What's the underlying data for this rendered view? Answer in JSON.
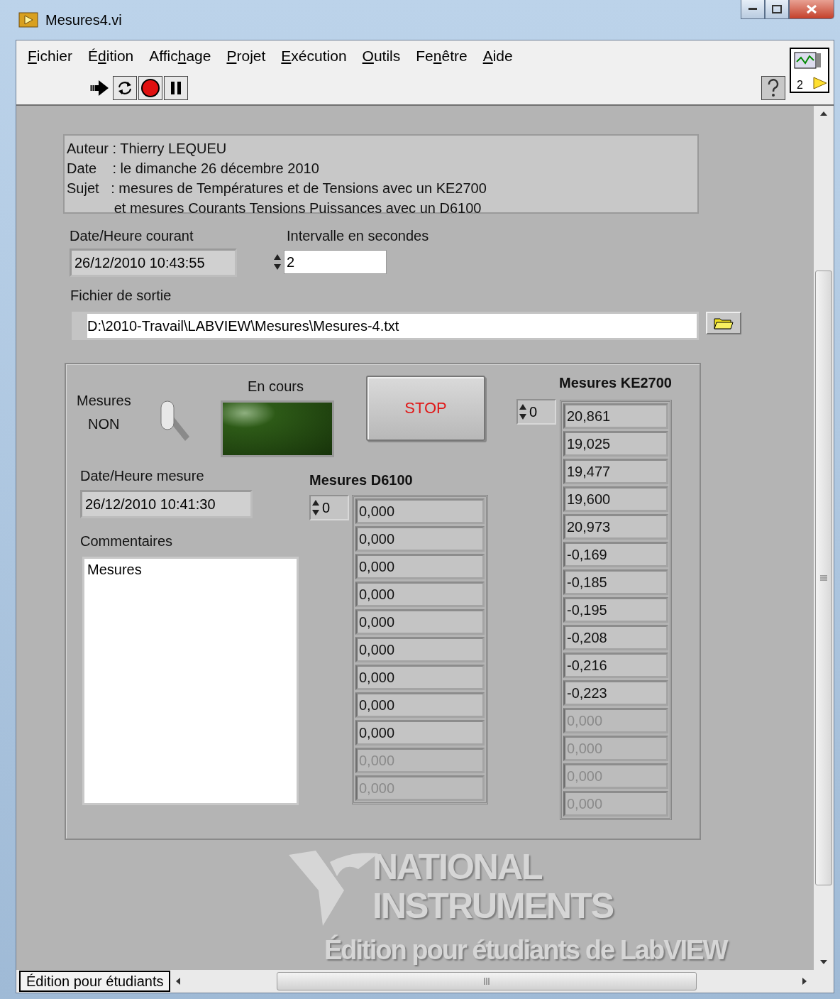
{
  "window": {
    "title": "Mesures4.vi"
  },
  "menu": [
    {
      "key": "F",
      "post": "ichier"
    },
    {
      "pre": "É",
      "key": "d",
      "post": "ition"
    },
    {
      "pre": "Affic",
      "key": "h",
      "post": "age"
    },
    {
      "key": "P",
      "post": "rojet"
    },
    {
      "key": "E",
      "post": "xécution"
    },
    {
      "key": "O",
      "post": "utils"
    },
    {
      "pre": "Fe",
      "key": "n",
      "post": "être"
    },
    {
      "key": "A",
      "post": "ide"
    }
  ],
  "connector_pane": {
    "label": "2"
  },
  "description": {
    "lines": [
      "Auteur : Thierry LEQUEU",
      "Date    : le dimanche 26 décembre 2010",
      "Sujet   : mesures de Températures et de Tensions avec un KE2700",
      "            et mesures Courants Tensions Puissances avec un D6100"
    ]
  },
  "current_datetime": {
    "label": "Date/Heure courant",
    "value": "26/12/2010 10:43:55"
  },
  "interval": {
    "label": "Intervalle en secondes",
    "value": "2"
  },
  "output_file": {
    "label": "Fichier de sortie",
    "value": "D:\\2010-Travail\\LABVIEW\\Mesures\\Mesures-4.txt"
  },
  "cluster": {
    "switch": {
      "label": "Mesures",
      "state_text": "NON",
      "on": false
    },
    "led": {
      "label": "En cours",
      "on": false
    },
    "stop_button": {
      "label": "STOP"
    },
    "measure_datetime": {
      "label": "Date/Heure mesure",
      "value": "26/12/2010 10:41:30"
    },
    "comments": {
      "label": "Commentaires",
      "value": "Mesures"
    },
    "d6100": {
      "title": "Mesures D6100",
      "index": "0",
      "values": [
        {
          "text": "0,000",
          "disabled": false
        },
        {
          "text": "0,000",
          "disabled": false
        },
        {
          "text": "0,000",
          "disabled": false
        },
        {
          "text": "0,000",
          "disabled": false
        },
        {
          "text": "0,000",
          "disabled": false
        },
        {
          "text": "0,000",
          "disabled": false
        },
        {
          "text": "0,000",
          "disabled": false
        },
        {
          "text": "0,000",
          "disabled": false
        },
        {
          "text": "0,000",
          "disabled": false
        },
        {
          "text": "0,000",
          "disabled": true
        },
        {
          "text": "0,000",
          "disabled": true
        }
      ]
    },
    "ke2700": {
      "title": "Mesures KE2700",
      "index": "0",
      "values": [
        {
          "text": "20,861",
          "disabled": false
        },
        {
          "text": "19,025",
          "disabled": false
        },
        {
          "text": "19,477",
          "disabled": false
        },
        {
          "text": "19,600",
          "disabled": false
        },
        {
          "text": "20,973",
          "disabled": false
        },
        {
          "text": "-0,169",
          "disabled": false
        },
        {
          "text": "-0,185",
          "disabled": false
        },
        {
          "text": "-0,195",
          "disabled": false
        },
        {
          "text": "-0,208",
          "disabled": false
        },
        {
          "text": "-0,216",
          "disabled": false
        },
        {
          "text": "-0,223",
          "disabled": false
        },
        {
          "text": "0,000",
          "disabled": true
        },
        {
          "text": "0,000",
          "disabled": true
        },
        {
          "text": "0,000",
          "disabled": true
        },
        {
          "text": "0,000",
          "disabled": true
        }
      ]
    }
  },
  "watermark": {
    "line1": "NATIONAL",
    "line2": "INSTRUMENTS",
    "line3": "Édition pour étudiants de LabVIEW"
  },
  "status_bar": {
    "label": "Édition pour étudiants"
  }
}
